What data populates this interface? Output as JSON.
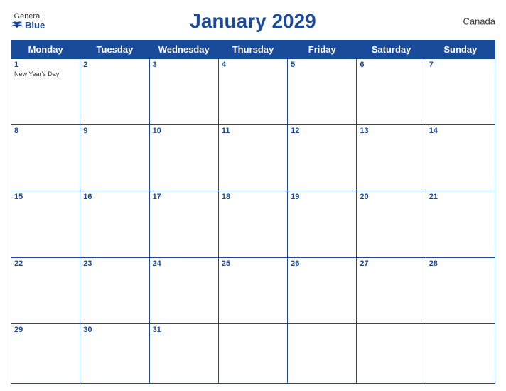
{
  "logo": {
    "general": "General",
    "blue": "Blue"
  },
  "title": "January 2029",
  "country": "Canada",
  "weekdays": [
    "Monday",
    "Tuesday",
    "Wednesday",
    "Thursday",
    "Friday",
    "Saturday",
    "Sunday"
  ],
  "weeks": [
    [
      {
        "day": "1",
        "holiday": "New Year's Day"
      },
      {
        "day": "2",
        "holiday": ""
      },
      {
        "day": "3",
        "holiday": ""
      },
      {
        "day": "4",
        "holiday": ""
      },
      {
        "day": "5",
        "holiday": ""
      },
      {
        "day": "6",
        "holiday": ""
      },
      {
        "day": "7",
        "holiday": ""
      }
    ],
    [
      {
        "day": "8",
        "holiday": ""
      },
      {
        "day": "9",
        "holiday": ""
      },
      {
        "day": "10",
        "holiday": ""
      },
      {
        "day": "11",
        "holiday": ""
      },
      {
        "day": "12",
        "holiday": ""
      },
      {
        "day": "13",
        "holiday": ""
      },
      {
        "day": "14",
        "holiday": ""
      }
    ],
    [
      {
        "day": "15",
        "holiday": ""
      },
      {
        "day": "16",
        "holiday": ""
      },
      {
        "day": "17",
        "holiday": ""
      },
      {
        "day": "18",
        "holiday": ""
      },
      {
        "day": "19",
        "holiday": ""
      },
      {
        "day": "20",
        "holiday": ""
      },
      {
        "day": "21",
        "holiday": ""
      }
    ],
    [
      {
        "day": "22",
        "holiday": ""
      },
      {
        "day": "23",
        "holiday": ""
      },
      {
        "day": "24",
        "holiday": ""
      },
      {
        "day": "25",
        "holiday": ""
      },
      {
        "day": "26",
        "holiday": ""
      },
      {
        "day": "27",
        "holiday": ""
      },
      {
        "day": "28",
        "holiday": ""
      }
    ],
    [
      {
        "day": "29",
        "holiday": ""
      },
      {
        "day": "30",
        "holiday": ""
      },
      {
        "day": "31",
        "holiday": ""
      },
      {
        "day": "",
        "holiday": ""
      },
      {
        "day": "",
        "holiday": ""
      },
      {
        "day": "",
        "holiday": ""
      },
      {
        "day": "",
        "holiday": ""
      }
    ]
  ],
  "colors": {
    "header_bg": "#1a4b9b",
    "header_text": "#ffffff",
    "title_color": "#1a4b9b",
    "border_color": "#1a4b9b"
  }
}
